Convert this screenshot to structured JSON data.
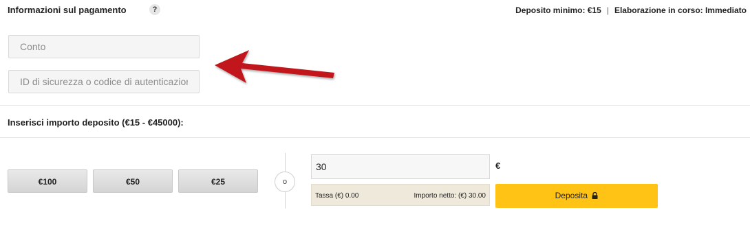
{
  "payment": {
    "title": "Informazioni sul pagamento",
    "help_symbol": "?",
    "min_deposit": "Deposito minimo: €15",
    "separator": "|",
    "processing": "Elaborazione in corso: Immediato",
    "account_placeholder": "Conto",
    "security_placeholder": "ID di sicurezza o codice di autenticazione"
  },
  "deposit": {
    "title": "Inserisci importo deposito (€15 - €45000):",
    "quick_amounts": [
      "€100",
      "€50",
      "€25"
    ],
    "or_label": "o",
    "amount_value": "30",
    "currency": "€",
    "fee_label": "Tassa (€) 0.00",
    "net_label": "Importo netto: (€) 30.00",
    "button_label": "Deposita"
  },
  "colors": {
    "accent": "#ffc316",
    "arrow": "#c0161b",
    "fee_bg": "#efe9dc"
  },
  "icons": {
    "help": "help-icon",
    "lock": "lock-icon",
    "arrow": "annotation-arrow"
  }
}
